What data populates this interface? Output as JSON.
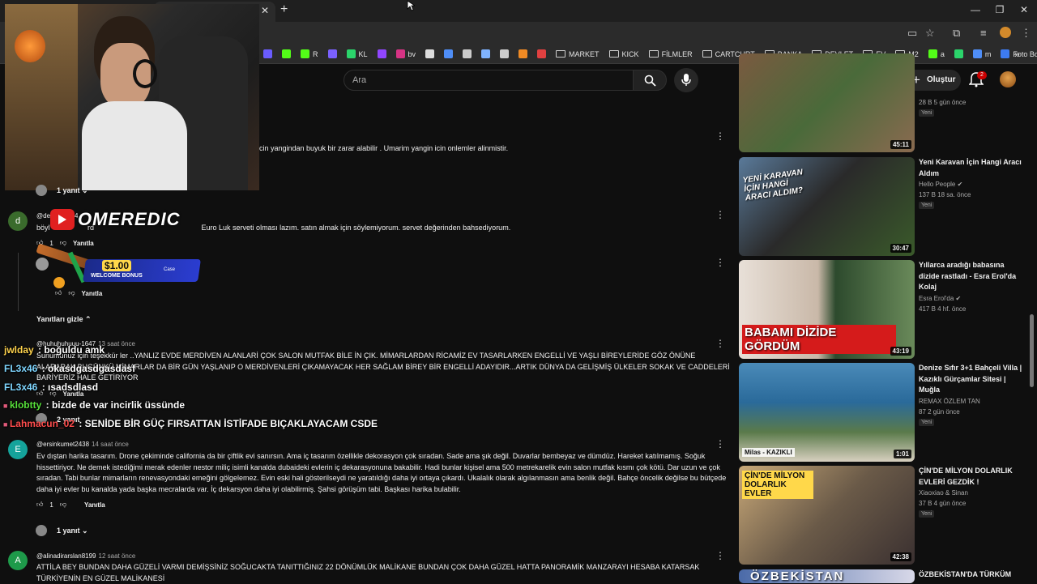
{
  "browser": {
    "bookmarks": [
      {
        "label": "",
        "color": "#6a5cff"
      },
      {
        "label": "",
        "color": "#53fc18"
      },
      {
        "label": "R",
        "color": "#53fc18"
      },
      {
        "label": "",
        "color": "#7b61ff"
      },
      {
        "label": "KL",
        "color": "#2bd46b"
      },
      {
        "label": "",
        "color": "#9146ff"
      },
      {
        "label": "bv",
        "color": "#d63384"
      },
      {
        "label": "",
        "color": "#dddddd"
      },
      {
        "label": "",
        "color": "#4f8ef7"
      },
      {
        "label": "",
        "color": "#cccccc"
      },
      {
        "label": "",
        "color": "#7fb3ff"
      },
      {
        "label": "",
        "color": "#cccccc"
      },
      {
        "label": "",
        "color": "#f08a24"
      },
      {
        "label": "",
        "color": "#e04040"
      }
    ],
    "folders": [
      "MARKET",
      "KICK",
      "FİLMLER",
      "CARTCURT",
      "BANKA",
      "DEVLET",
      "EV",
      "M2"
    ],
    "extra_bookmarks": [
      {
        "label": "a",
        "color": "#53fc18"
      },
      {
        "label": "",
        "color": "#2bd46b"
      },
      {
        "label": "m",
        "color": "#4f8ef7"
      },
      {
        "label": "Foto Boyutlandırıcı",
        "color": "#3d7bf2"
      }
    ],
    "more": "»"
  },
  "youtube": {
    "search_placeholder": "Ara",
    "create_label": "Oluştur",
    "notification_count": "2"
  },
  "stream_overlay": {
    "channel_logo_text": "OMEREDIC",
    "ad_amount": "$1.00",
    "ad_text": "WELCOME BONUS",
    "ad_brand": "Case"
  },
  "comments": {
    "c1": {
      "text": "cin yangindan buyuk bir zarar alabilir . Umarim yangin icin onlemler alinmistir.",
      "replies": "1 yanıt"
    },
    "c2": {
      "author": "@de",
      "author_tail": "4",
      "text_start": "böyl",
      "text": "rd                                                     Euro Luk serveti olması lazım. satın almak için söylemiyorum. servet değerinden bahsediyorum.",
      "likes": "1",
      "reply_label": "Yanıtla"
    },
    "c2_reply": {
      "reply_label": "Yanıtla"
    },
    "hide_replies": "Yanıtları gizle",
    "c3": {
      "author": "@huhuhuhuuu-1647",
      "time": "13 saat önce",
      "text": "Sunumunuz için teşekkür ler ..YANLIZ EVDE MERDİVEN ALANLARİ ÇOK SALON MUTFAK BİLE İN ÇIK. MİMARLARDAN RİCAMİZ EV TASARLARKEN ENGELLİ VE YAŞLI BİREYLERİDE GÖZ ÖNÜNE ALARARAK BUGÜNKÜ MİMARLAR DA BİR GÜN YAŞLANIP O MERDİVENLERİ ÇIKAMAYACAK HER SAĞLAM BİREY BİR ENGELLİ ADAYIDIR...ARTIK DÜNYA DA GELİŞMİŞ ÜLKELER SOKAK VE CADDELERİ BARİYERİZ HALE GETİRİYOR",
      "reply_label": "Yanıtla",
      "replies": "2 yanıt"
    },
    "c4": {
      "initial": "E",
      "author": "@ersinkumet2438",
      "time": "14 saat önce",
      "text": "Ev dıştan harika tasarım. Drone çekiminde california da bir çiftlik evi sanırsın. Ama iç tasarım özellikle dekorasyon çok sıradan. Sade ama şık değil. Duvarlar bembeyaz ve dümdüz. Hareket katılmamış. Soğuk hissettiriyor. Ne demek istediğimi merak edenler nestor miliç isimli kanalda dubaideki evlerin iç dekarasyonuna bakabilir. Hadi bunlar kişisel ama 500 metrekarelik evin salon mutfak kısmı çok kötü. Dar uzun ve çok sıradan. Tabi bunlar mimarların renevasyondaki emeğini gölgelemez. Evin eski hali gösterilseydi ne yaratıldığı daha iyi ortaya çıkardı. Ukalalık olarak algılanmasın ama benlik değil. Bahçe öncelik değilse bu bütçede daha iyi evler bu kanalda yada başka mecralarda var. İç dekarsyon daha iyi olabilirmiş. Şahsi görüşüm tabi. Başkası harika bulabilir.",
      "likes": "1",
      "reply_label": "Yanıtla",
      "replies": "1 yanıt"
    },
    "c5": {
      "initial": "A",
      "author": "@alinadirarslan8199",
      "time": "12 saat önce",
      "text": "ATTİLA BEY BUNDAN DAHA GÜZELİ VARMI DEMİŞSİNİZ SOĞUCAKTA TANITTIĞINIZ 22 DÖNÜMLÜK MALİKANE BUNDAN ÇOK DAHA GÜZEL HATTA PANORAMİK MANZARAYI HESABA KATARSAK TÜRKİYENİN EN GÜZEL MALİKANESİ"
    },
    "c1_initial": "d"
  },
  "chat": [
    {
      "user": "jwlday",
      "color": "#ffd34d",
      "msg": "boğuldu amk"
    },
    {
      "user": "FL3x46",
      "color": "#7fd6ff",
      "msg": "okasdgasdgasdasf"
    },
    {
      "user": "FL3x46",
      "color": "#7fd6ff",
      "msg": "ısadsdlasd"
    },
    {
      "user": "klobtty",
      "color": "#57e03a",
      "msg": "bizde de var incirlik üssünde"
    },
    {
      "user": "Lahmacun_02",
      "color": "#ff4d4d",
      "msg": "SENİDE BİR GÜÇ FIRSATTAN İSTİFADE BIÇAKLAYACAM CSDE"
    }
  ],
  "sidebar": [
    {
      "title": "",
      "channel": "",
      "meta": "28 B  5 gün önce",
      "badge": "Yeni",
      "duration": "45:11",
      "verified": false
    },
    {
      "title": "Yeni Karavan İçin Hangi Aracı Aldım",
      "channel": "Hello People",
      "meta": "137 B  18 sa. önce",
      "badge": "Yeni",
      "duration": "30:47",
      "verified": true,
      "thumb_text": "YENİ KARAVAN İÇİN HANGİ ARACI ALDIM?"
    },
    {
      "title": "Yıllarca aradığı babasına dizide rastladı - Esra Erol'da Kolaj",
      "channel": "Esra Erol'da",
      "meta": "417 B  4 hf. önce",
      "badge": "",
      "duration": "43:19",
      "verified": true,
      "thumb_text": "BABAMI DİZİDE GÖRDÜM"
    },
    {
      "title": "Denize Sıfır 3+1 Bahçeli Villa | Kazıklı Gürçamlar Sitesi | Muğla",
      "channel": "REMAX ÖZLEM TAN",
      "meta": "87  2 gün önce",
      "badge": "Yeni",
      "duration": "1:01",
      "verified": false,
      "thumb_text": "Milas - KAZIKLI"
    },
    {
      "title": "ÇİN'DE MİLYON DOLARLIK EVLERİ GEZDİK !",
      "channel": "Xiaoxiao & Sinan",
      "meta": "37 B  4 gün önce",
      "badge": "Yeni",
      "duration": "42:38",
      "verified": false,
      "thumb_text": "ÇİN'DE MİLYON DOLARLIK EVLER"
    },
    {
      "title": "ÖZBEKİSTAN'DA TÜRKÜM",
      "channel": "",
      "meta": "",
      "badge": "",
      "duration": "",
      "verified": false,
      "thumb_text": "ÖZBEKİSTAN"
    }
  ]
}
